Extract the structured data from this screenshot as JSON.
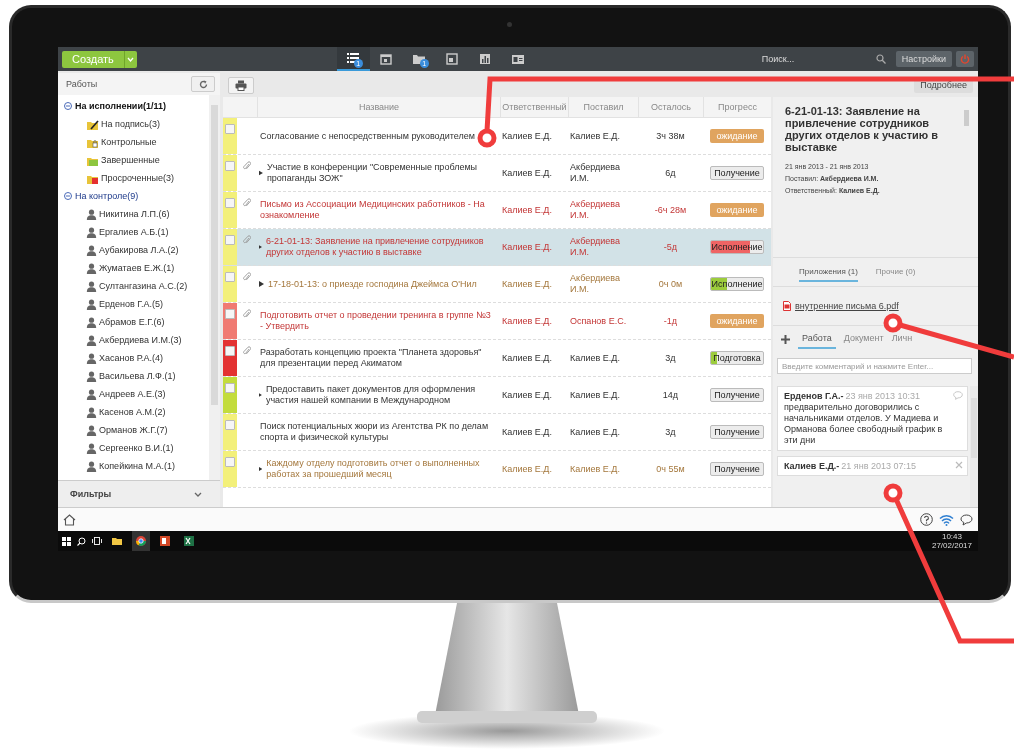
{
  "topbar": {
    "create_button": "Создать",
    "nav_tabs": [
      {
        "badge": "1",
        "selected": true
      },
      {
        "selected": false
      },
      {
        "badge": "1",
        "selected": false
      },
      {
        "selected": false
      },
      {
        "selected": false
      },
      {
        "selected": false
      }
    ],
    "search": {
      "placeholder": "Поиск..."
    },
    "settings_button": "Настройки"
  },
  "sidebar": {
    "title": "Работы",
    "tree": [
      {
        "label": "На исполнении(1/11)",
        "expanded": true,
        "selected": true,
        "children": [
          {
            "label": "На подпись(3)",
            "kind": "folder"
          },
          {
            "label": "Контрольные",
            "kind": "folder"
          },
          {
            "label": "Завершенные",
            "kind": "folder"
          },
          {
            "label": "Просроченные(3)",
            "kind": "folder"
          }
        ]
      },
      {
        "label": "На контроле(9)",
        "expanded": true,
        "selected": false,
        "children": [
          {
            "label": "Никитина Л.П.(6)",
            "kind": "person"
          },
          {
            "label": "Ергалиев А.Б.(1)",
            "kind": "person"
          },
          {
            "label": "Аубакирова Л.А.(2)",
            "kind": "person"
          },
          {
            "label": "Жуматаев Е.Ж.(1)",
            "kind": "person"
          },
          {
            "label": "Султангазина А.С.(2)",
            "kind": "person"
          },
          {
            "label": "Ерденов Г.А.(5)",
            "kind": "person"
          },
          {
            "label": "Абрамов Е.Г.(6)",
            "kind": "person"
          },
          {
            "label": "Акбердиева И.М.(3)",
            "kind": "person"
          },
          {
            "label": "Хасанов Р.А.(4)",
            "kind": "person"
          },
          {
            "label": "Васильева Л.Ф.(1)",
            "kind": "person"
          },
          {
            "label": "Андреев А.Е.(3)",
            "kind": "person"
          },
          {
            "label": "Касенов А.М.(2)",
            "kind": "person"
          },
          {
            "label": "Орманов Ж.Г.(7)",
            "kind": "person"
          },
          {
            "label": "Сергеенко В.И.(1)",
            "kind": "person"
          },
          {
            "label": "Копейкина М.А.(1)",
            "kind": "person"
          }
        ]
      }
    ],
    "filters": "Фильтры"
  },
  "table": {
    "columns": [
      "Название",
      "Ответственный",
      "Поставил",
      "Осталось",
      "Прогресс"
    ],
    "rows": [
      {
        "color": "#f3f07a",
        "checked": false,
        "attachment": false,
        "expandable": false,
        "overdue": false,
        "waiting": false,
        "selected": false,
        "name": "Согласование с непосредственным руководителем",
        "responsible": "Калиев Е.Д.",
        "assigned_by": "Калиев Е.Д.",
        "remaining": "3ч 38м",
        "progress": {
          "kind": "status",
          "label": "ожидание"
        }
      },
      {
        "color": "#f3f07a",
        "checked": false,
        "attachment": true,
        "expandable": true,
        "overdue": false,
        "waiting": false,
        "selected": false,
        "name": "Участие в конференции \"Современные проблемы пропаганды ЗОЖ\"",
        "responsible": "Калиев Е.Д.",
        "assigned_by": "Акбердиева И.М.",
        "remaining": "6д",
        "progress": {
          "kind": "button",
          "label": "Получение"
        }
      },
      {
        "color": "#f3f07a",
        "checked": false,
        "attachment": true,
        "expandable": false,
        "overdue": true,
        "waiting": false,
        "selected": false,
        "name": "Письмо из Ассоциации Медицинских работников - На ознакомление",
        "responsible": "Калиев Е.Д.",
        "assigned_by": "Акбердиева И.М.",
        "remaining": "-6ч 28м",
        "progress": {
          "kind": "status",
          "label": "ожидание"
        }
      },
      {
        "color": "#f3f07a",
        "checked": false,
        "attachment": true,
        "expandable": true,
        "overdue": true,
        "waiting": false,
        "selected": true,
        "name": "6-21-01-13: Заявление на привлечение сотрудников других отделов к участию в выставке",
        "responsible": "Калиев Е.Д.",
        "assigned_by": "Акбердиева И.М.",
        "remaining": "-5д",
        "progress": {
          "kind": "button",
          "label": "Исполнение",
          "level": 0.75,
          "color": "#ef6464"
        }
      },
      {
        "color": "#f3f07a",
        "checked": false,
        "attachment": true,
        "expandable": true,
        "overdue": false,
        "waiting": true,
        "selected": false,
        "name": "17-18-01-13: о приезде господина Джеймса О'Нил",
        "responsible": "Калиев Е.Д.",
        "assigned_by": "Акбердиева И.М.",
        "remaining": "0ч 0м",
        "progress": {
          "kind": "button",
          "label": "Исполнение",
          "level": 0.3,
          "color": "#9ccc3c"
        }
      },
      {
        "color": "#f07a72",
        "checked": false,
        "attachment": true,
        "expandable": false,
        "overdue": true,
        "waiting": false,
        "selected": false,
        "name": "Подготовить отчет о проведении тренинга в группе №3 - Утвердить",
        "responsible": "Калиев Е.Д.",
        "assigned_by": "Оспанов Е.С.",
        "remaining": "-1д",
        "progress": {
          "kind": "status",
          "label": "ожидание"
        }
      },
      {
        "color": "#e33232",
        "checked": false,
        "attachment": true,
        "expandable": false,
        "overdue": false,
        "waiting": false,
        "selected": false,
        "name": "Разработать концепцию проекта \"Планета здоровья\" для презентации перед Акиматом",
        "responsible": "Калиев Е.Д.",
        "assigned_by": "Калиев Е.Д.",
        "remaining": "3д",
        "progress": {
          "kind": "button",
          "label": "Подготовка",
          "level": 0.12,
          "color": "#9ccc3c"
        }
      },
      {
        "color": "#c3dc3c",
        "checked": false,
        "attachment": false,
        "expandable": true,
        "overdue": false,
        "waiting": false,
        "selected": false,
        "name": "Предоставить пакет документов для оформления участия нашей компании в Международном",
        "responsible": "Калиев Е.Д.",
        "assigned_by": "Калиев Е.Д.",
        "remaining": "14д",
        "progress": {
          "kind": "button",
          "label": "Получение"
        }
      },
      {
        "color": "#f3f07a",
        "checked": false,
        "attachment": false,
        "expandable": false,
        "overdue": false,
        "waiting": false,
        "selected": false,
        "name": "Поиск потенциальных жюри из Агентства РК по делам спорта и физической культуры",
        "responsible": "Калиев Е.Д.",
        "assigned_by": "Калиев Е.Д.",
        "remaining": "3д",
        "progress": {
          "kind": "button",
          "label": "Получение"
        }
      },
      {
        "color": "#f3f07a",
        "checked": false,
        "attachment": false,
        "expandable": true,
        "overdue": false,
        "waiting": true,
        "selected": false,
        "name": "Каждому отделу подготовить отчет о выполненных работах за прошедший месяц",
        "responsible": "Калиев Е.Д.",
        "assigned_by": "Калиев Е.Д.",
        "remaining": "0ч 55м",
        "progress": {
          "kind": "button",
          "label": "Получение"
        }
      }
    ]
  },
  "details": {
    "more_button": "Подробнее",
    "title": "6-21-01-13: Заявление на привлечение сотрудников других отделов к участию в выставке",
    "dates": "21 янв 2013 - 21 янв 2013",
    "assigned_by": "Поставил: **Акбердиева И.М.**",
    "responsible": "Ответственный: **Калиев Е.Д.**",
    "file_tabs": [
      {
        "label": "Приложения (1)",
        "selected": true
      },
      {
        "label": "Прочие (0)",
        "selected": false
      }
    ],
    "files": [
      "внутренние письма 6.pdf"
    ],
    "comment_tabs": [
      {
        "label": "Работа",
        "selected": true
      },
      {
        "label": "Документ",
        "selected": false
      },
      {
        "label": "Личн",
        "selected": false
      }
    ],
    "comment_input": {
      "placeholder": "Введите комментарий и нажмите Enter..."
    },
    "comments": [
      {
        "author": "Ерденов Г.А.-",
        "date": "23 янв 2013 10:31",
        "text": "предварительно договорились с начальниками отделов. У Мадиева и Орманова более свободный график в эти дни"
      },
      {
        "author": "Калиев Е.Д.-",
        "date": "21 янв 2013 07:15"
      }
    ]
  },
  "taskbar": {
    "time": "10:43",
    "date": "27/02/2017"
  }
}
